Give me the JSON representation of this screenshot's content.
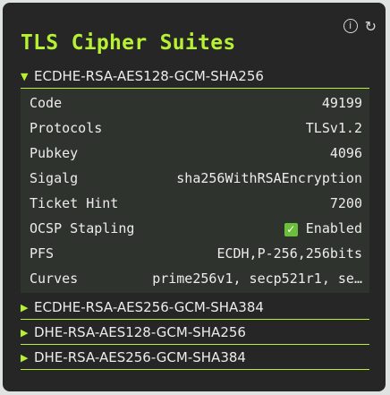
{
  "panel": {
    "title": "TLS Cipher Suites",
    "info_icon": "ⓘ",
    "refresh_icon": "↻"
  },
  "suites": [
    {
      "name": "ECDHE-RSA-AES128-GCM-SHA256",
      "expanded": true,
      "details": {
        "code_label": "Code",
        "code": "49199",
        "protocols_label": "Protocols",
        "protocols": "TLSv1.2",
        "pubkey_label": "Pubkey",
        "pubkey": "4096",
        "sigalg_label": "Sigalg",
        "sigalg": "sha256WithRSAEncryption",
        "ticket_label": "Ticket Hint",
        "ticket": "7200",
        "ocsp_label": "OCSP Stapling",
        "ocsp": "Enabled",
        "ocsp_checked": true,
        "pfs_label": "PFS",
        "pfs": "ECDH,P-256,256bits",
        "curves_label": "Curves",
        "curves": "prime256v1, secp521r1, se…"
      }
    },
    {
      "name": "ECDHE-RSA-AES256-GCM-SHA384",
      "expanded": false
    },
    {
      "name": "DHE-RSA-AES128-GCM-SHA256",
      "expanded": false
    },
    {
      "name": "DHE-RSA-AES256-GCM-SHA384",
      "expanded": false
    }
  ],
  "colors": {
    "accent": "#b6f233",
    "panel_bg": "#262626",
    "detail_bg": "#2f332e"
  }
}
